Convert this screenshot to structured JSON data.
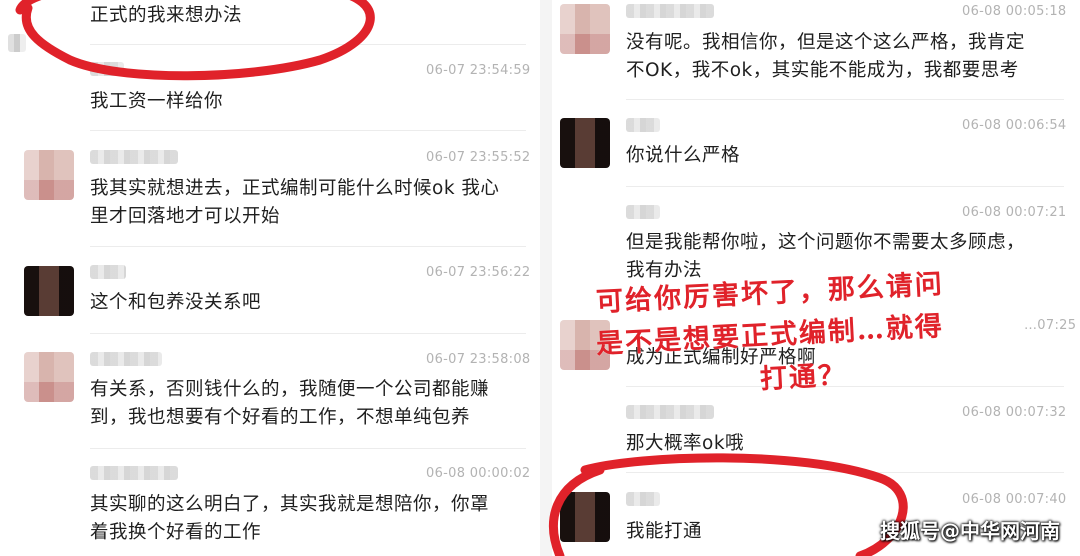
{
  "left_messages": [
    {
      "time": "",
      "text": "正式的我来想办法"
    },
    {
      "time": "06-07 23:54:59",
      "text": "我工资一样给你"
    },
    {
      "time": "06-07 23:55:52",
      "text": "我其实就想进去，正式编制可能什么时候ok 我心\n里才回落地才可以开始"
    },
    {
      "time": "06-07 23:56:22",
      "text": "这个和包养没关系吧"
    },
    {
      "time": "06-07 23:58:08",
      "text": "有关系，否则钱什么的，我随便一个公司都能赚\n到，我也想要有个好看的工作，不想单纯包养"
    },
    {
      "time": "06-08 00:00:02",
      "text": "其实聊的这么明白了，其实我就是想陪你，你罩\n着我换个好看的工作"
    }
  ],
  "right_messages": [
    {
      "time": "06-08 00:05:18",
      "text": "没有呢。我相信你，但是这个这么严格，我肯定\n不OK，我不ok，其实能不能成为，我都要思考"
    },
    {
      "time": "06-08 00:06:54",
      "text": "你说什么严格"
    },
    {
      "time": "06-08 00:07:21",
      "text": "但是我能帮你啦，这个问题你不需要太多顾虑，\n我有办法"
    },
    {
      "time": "…07:25",
      "text": "成为正式编制好严格啊"
    },
    {
      "time": "06-08 00:07:32",
      "text": "那大概率ok哦"
    },
    {
      "time": "06-08 00:07:40",
      "text": "我能打通"
    }
  ],
  "caption": {
    "line1": "可给你厉害坏了，那么请问",
    "line2": "是不是想要正式编制…就得",
    "line3": "打通？"
  },
  "watermark": "搜狐号@中华网河南",
  "colors": {
    "annotation_red": "#e0222a",
    "time_gray": "#b3b3b3",
    "divider": "#ececec"
  }
}
